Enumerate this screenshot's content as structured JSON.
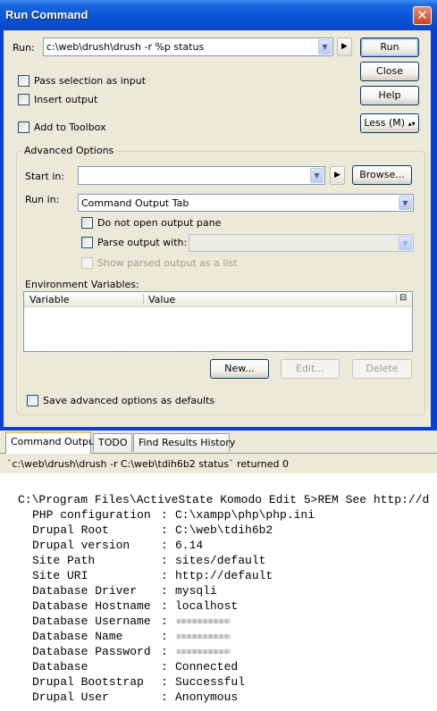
{
  "dialog": {
    "title": "Run Command",
    "run_label": "Run:",
    "command_value": "c:\\web\\drush\\drush -r %p status",
    "buttons": {
      "run": "Run",
      "close": "Close",
      "help": "Help",
      "less": "Less (M)"
    },
    "checkboxes": {
      "pass_selection": "Pass selection as input",
      "insert_output": "Insert output",
      "add_toolbox": "Add to Toolbox"
    },
    "advanced": {
      "legend": "Advanced Options",
      "start_in_label": "Start in:",
      "start_in_value": "",
      "browse": "Browse...",
      "run_in_label": "Run in:",
      "run_in_value": "Command Output Tab",
      "no_output_pane": "Do not open output pane",
      "parse_output": "Parse output with:",
      "show_parsed": "Show parsed output as a list",
      "env_label": "Environment Variables:",
      "env_columns": [
        "Variable",
        "Value"
      ],
      "new_btn": "New...",
      "edit_btn": "Edit...",
      "delete_btn": "Delete",
      "save_defaults": "Save advanced options as defaults"
    }
  },
  "output": {
    "tabs": [
      "Command Output",
      "TODO",
      "Find Results History"
    ],
    "status": "`c:\\web\\drush\\drush -r C:\\web\\tdih6b2 status` returned 0",
    "prompt_line": "C:\\Program Files\\ActiveState Komodo Edit 5>REM See http://d",
    "rows": [
      {
        "key": "PHP configuration",
        "value": "C:\\xampp\\php\\php.ini"
      },
      {
        "key": "Drupal Root",
        "value": "C:\\web\\tdih6b2"
      },
      {
        "key": "Drupal version",
        "value": "6.14"
      },
      {
        "key": "Site Path",
        "value": "sites/default"
      },
      {
        "key": "Site URI",
        "value": "http://default"
      },
      {
        "key": "Database Driver",
        "value": "mysqli"
      },
      {
        "key": "Database Hostname",
        "value": "localhost"
      },
      {
        "key": "Database Username",
        "value": ""
      },
      {
        "key": "Database Name",
        "value": ""
      },
      {
        "key": "Database Password",
        "value": ""
      },
      {
        "key": "Database",
        "value": "Connected"
      },
      {
        "key": "Drupal Bootstrap",
        "value": "Successful"
      },
      {
        "key": "Drupal User",
        "value": "Anonymous"
      }
    ]
  }
}
